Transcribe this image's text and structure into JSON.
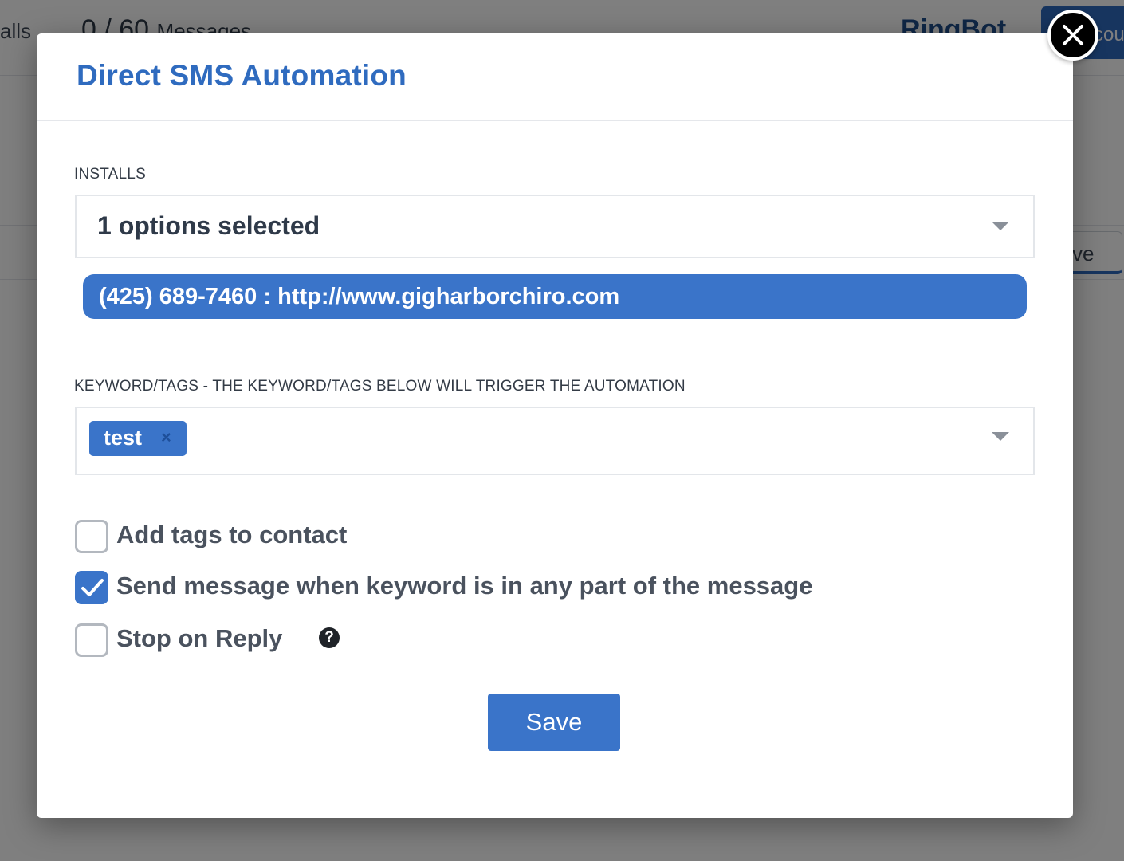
{
  "background": {
    "nav_text": "alls",
    "counter": "0 / 60",
    "counter_suffix": "Messages",
    "brand": "RingBot",
    "account_button": "cou",
    "right_button": "ve"
  },
  "modal": {
    "title": "Direct SMS Automation",
    "installs": {
      "label": "INSTALLS",
      "selected_summary": "1 options selected",
      "selected_options": [
        "(425) 689-7460 : http://www.gigharborchiro.com"
      ]
    },
    "keywords": {
      "label": "KEYWORD/TAGS - THE KEYWORD/TAGS BELOW WILL TRIGGER THE AUTOMATION",
      "tags": [
        "test"
      ],
      "remove_symbol": "×"
    },
    "options": [
      {
        "label": "Add tags to contact",
        "checked": false
      },
      {
        "label": "Send message when keyword is in any part of the message",
        "checked": true
      },
      {
        "label": "Stop on Reply",
        "checked": false
      }
    ],
    "help_symbol": "?",
    "save_label": "Save"
  },
  "colors": {
    "accent": "#3a74c9",
    "title": "#2f6bbf",
    "overlay": "rgba(0,0,0,0.5)"
  },
  "icons": {
    "close": "close-icon",
    "caret": "chevron-down-icon",
    "check": "check-icon",
    "help": "question-circle-icon"
  }
}
